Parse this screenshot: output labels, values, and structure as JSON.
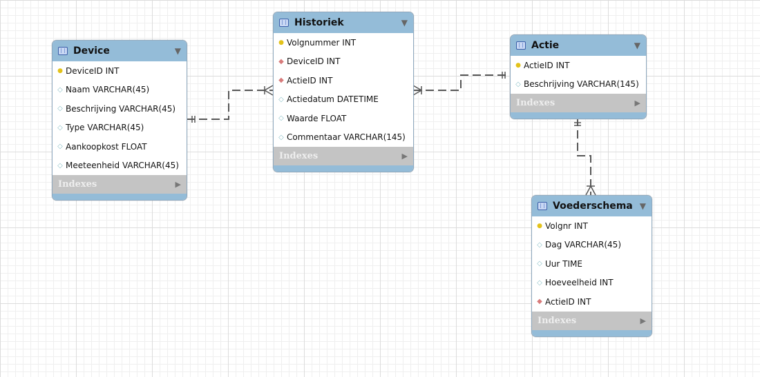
{
  "tables": [
    {
      "name": "Device",
      "columns": [
        {
          "label": "DeviceID INT",
          "kind": "pk"
        },
        {
          "label": "Naam VARCHAR(45)",
          "kind": "col"
        },
        {
          "label": "Beschrijving VARCHAR(45)",
          "kind": "col"
        },
        {
          "label": "Type VARCHAR(45)",
          "kind": "col"
        },
        {
          "label": "Aankoopkost FLOAT",
          "kind": "col"
        },
        {
          "label": "Meeteenheid VARCHAR(45)",
          "kind": "col"
        }
      ],
      "indexes": "Indexes"
    },
    {
      "name": "Historiek",
      "columns": [
        {
          "label": "Volgnummer INT",
          "kind": "pk"
        },
        {
          "label": "DeviceID INT",
          "kind": "fk"
        },
        {
          "label": "ActieID INT",
          "kind": "fk"
        },
        {
          "label": "Actiedatum DATETIME",
          "kind": "col"
        },
        {
          "label": "Waarde FLOAT",
          "kind": "col"
        },
        {
          "label": "Commentaar VARCHAR(145)",
          "kind": "col"
        }
      ],
      "indexes": "Indexes"
    },
    {
      "name": "Actie",
      "columns": [
        {
          "label": "ActieID INT",
          "kind": "pk"
        },
        {
          "label": "Beschrijving VARCHAR(145)",
          "kind": "col"
        }
      ],
      "indexes": "Indexes"
    },
    {
      "name": "Voederschema",
      "columns": [
        {
          "label": "Volgnr INT",
          "kind": "pk"
        },
        {
          "label": "Dag VARCHAR(45)",
          "kind": "col"
        },
        {
          "label": "Uur TIME",
          "kind": "col"
        },
        {
          "label": "Hoeveelheid INT",
          "kind": "col"
        },
        {
          "label": "ActieID INT",
          "kind": "fk"
        }
      ],
      "indexes": "Indexes"
    }
  ],
  "relationships": [
    {
      "from": "Device",
      "to": "Historiek",
      "type": "one-to-many"
    },
    {
      "from": "Actie",
      "to": "Historiek",
      "type": "one-to-many"
    },
    {
      "from": "Actie",
      "to": "Voederschema",
      "type": "one-to-many"
    }
  ],
  "colors": {
    "header": "#94bcd8",
    "indexes": "#c4c4c4",
    "line": "#555555"
  }
}
